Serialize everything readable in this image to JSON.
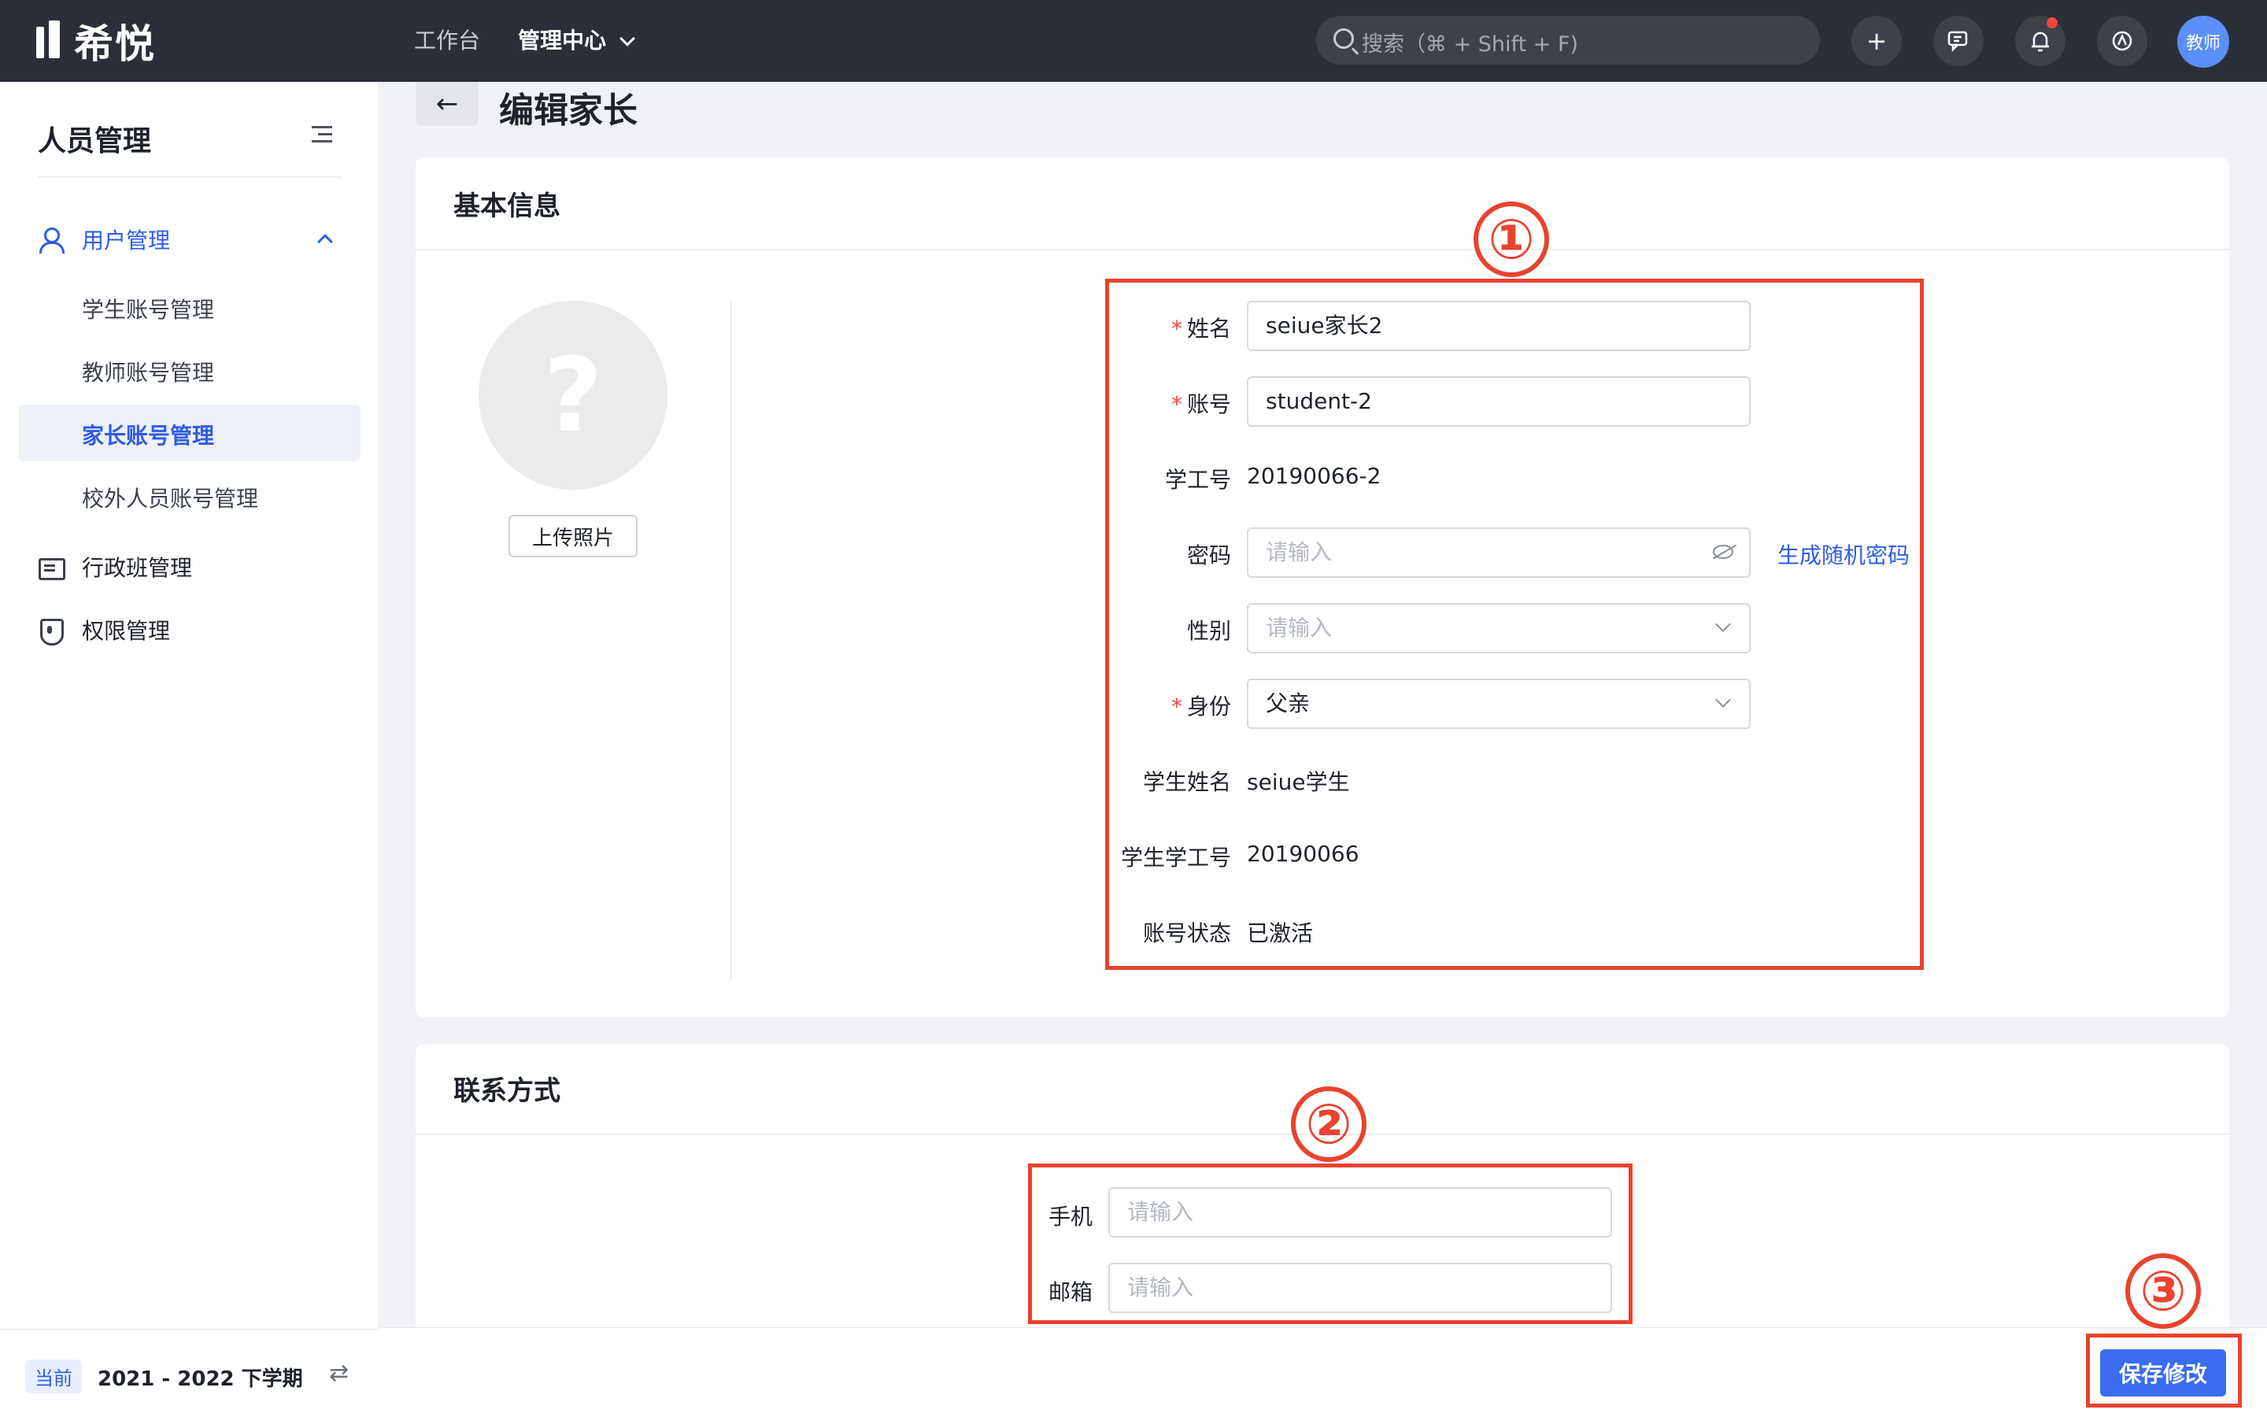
{
  "brand": {
    "name": "希悦"
  },
  "topnav": {
    "workbench": "工作台",
    "admin_center": "管理中心",
    "search_placeholder": "搜索（⌘ + Shift + F)",
    "add_icon": "+",
    "avatar_label": "教师"
  },
  "sidebar": {
    "title": "人员管理",
    "group_user": "用户管理",
    "sub_items": [
      "学生账号管理",
      "教师账号管理",
      "家长账号管理",
      "校外人员账号管理"
    ],
    "item_class": "行政班管理",
    "item_permission": "权限管理",
    "term_badge": "当前",
    "term_text": "2021 - 2022 下学期"
  },
  "page": {
    "back_icon": "←",
    "title": "编辑家长"
  },
  "basic_info": {
    "title": "基本信息",
    "photo_placeholder": "?",
    "upload_label": "上传照片",
    "name_label": "姓名",
    "name_value": "seiue家长2",
    "account_label": "账号",
    "account_value": "student-2",
    "staff_no_label": "学工号",
    "staff_no_value": "20190066-2",
    "password_label": "密码",
    "password_placeholder": "请输入",
    "gen_password": "生成随机密码",
    "gender_label": "性别",
    "gender_placeholder": "请输入",
    "identity_label": "身份",
    "identity_value": "父亲",
    "student_name_label": "学生姓名",
    "student_name_value": "seiue学生",
    "student_no_label": "学生学工号",
    "student_no_value": "20190066",
    "status_label": "账号状态",
    "status_value": "已激活",
    "required_mark": "*"
  },
  "contact": {
    "title": "联系方式",
    "phone_label": "手机",
    "phone_placeholder": "请输入",
    "email_label": "邮箱",
    "email_placeholder": "请输入"
  },
  "annotations": [
    "①",
    "②",
    "③"
  ],
  "actions": {
    "save": "保存修改"
  },
  "colors": {
    "topbar": "#2b2f38",
    "primary": "#2f5ce6",
    "annotation": "#e8432f",
    "required": "#f5443c"
  }
}
